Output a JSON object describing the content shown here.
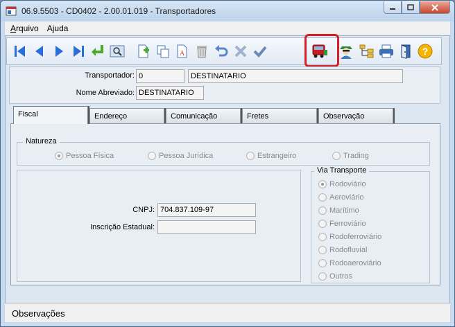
{
  "window": {
    "title": "06.9.5503 - CD0402 - 2.00.01.019 - Transportadores"
  },
  "menu": {
    "items": [
      {
        "label_acc": "A",
        "label_rest": "rquivo"
      },
      {
        "label_acc": "",
        "label_pre": "A",
        "label_mid": "j",
        "label_rest": "uda"
      }
    ]
  },
  "toolbar": {
    "buttons": [
      "first-icon",
      "prev-icon",
      "next-icon",
      "last-icon",
      "goto-icon",
      "search-icon",
      "add-icon",
      "copy-icon",
      "edit-icon",
      "delete-icon",
      "undo-icon",
      "cancel-icon",
      "confirm-icon",
      "truck-icon",
      "user-icon",
      "tree-icon",
      "print-icon",
      "exit-icon",
      "help-icon"
    ]
  },
  "header": {
    "transportador_label": "Transportador:",
    "transportador_code": "0",
    "transportador_name": "DESTINATARIO",
    "nome_abreviado_label": "Nome Abreviado:",
    "nome_abreviado_value": "DESTINATARIO"
  },
  "tabs": [
    "Fiscal",
    "Endereço",
    "Comunicação",
    "Fretes",
    "Observação"
  ],
  "natureza": {
    "title": "Natureza",
    "options": [
      "Pessoa Física",
      "Pessoa Jurídica",
      "Estrangeiro",
      "Trading"
    ],
    "selected": "Pessoa Física"
  },
  "fiscal": {
    "cnpj_label": "CNPJ:",
    "cnpj_value": "704.837.109-97",
    "ie_label": "Inscrição Estadual:",
    "ie_value": ""
  },
  "via_transporte": {
    "title": "Via Transporte",
    "options": [
      "Rodoviário",
      "Aeroviário",
      "Marítimo",
      "Ferroviário",
      "Rodoferroviário",
      "Rodofluvial",
      "Rodoaeroviário",
      "Outros"
    ],
    "selected": "Rodoviário"
  },
  "status": {
    "text": "Observações"
  }
}
